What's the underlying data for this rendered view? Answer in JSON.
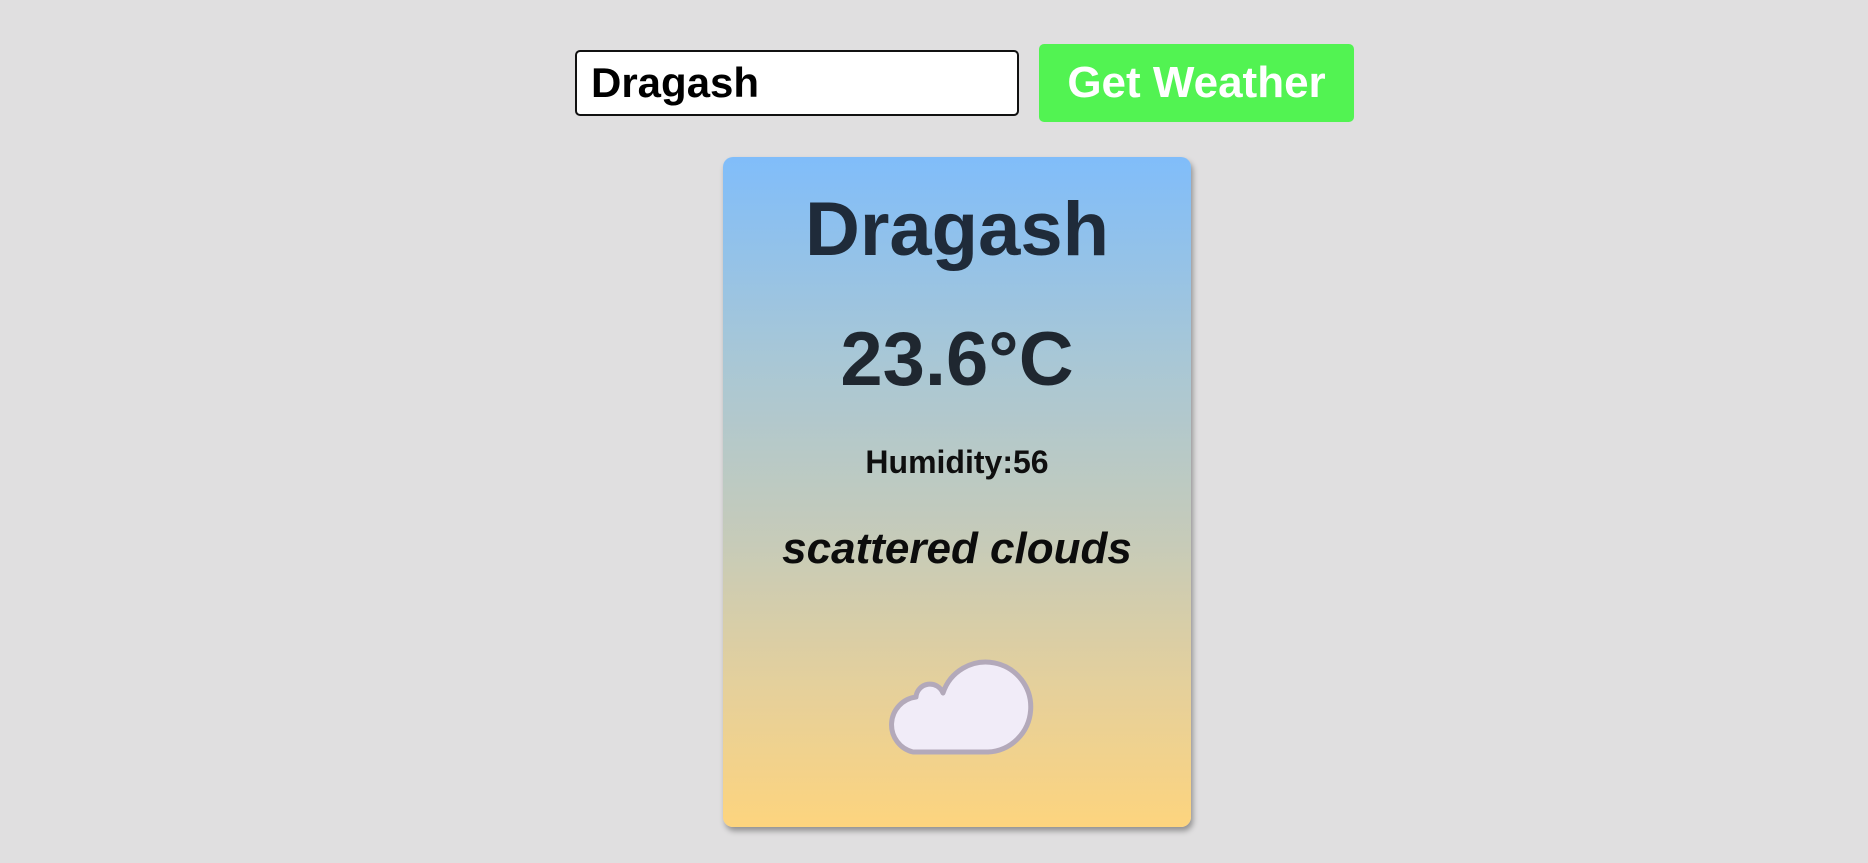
{
  "search": {
    "value": "Dragash",
    "button_label": "Get Weather"
  },
  "weather": {
    "city": "Dragash",
    "temperature": "23.6°C",
    "humidity_label": "Humidity:",
    "humidity_value": "56",
    "description": "scattered clouds",
    "icon": "cloud-icon"
  },
  "colors": {
    "page_background": "#e0dfe0",
    "button_background": "#52f352",
    "card_gradient_top": "#80bdfa",
    "card_gradient_bottom": "#fdd47e",
    "cloud_fill": "#f1ecf8",
    "cloud_stroke": "#b3a9ba"
  }
}
